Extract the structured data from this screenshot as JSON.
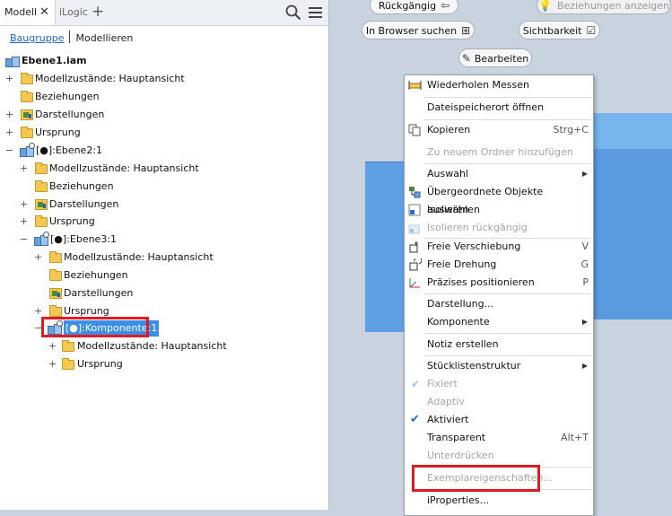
{
  "tabs": {
    "model": "Modell",
    "ilogic": "iLogic",
    "add": "+"
  },
  "modes": {
    "assembly": "Baugruppe",
    "modeling": "Modellieren"
  },
  "tree": {
    "root": "Ebene1.iam",
    "n1": "Modellzustände: Hauptansicht",
    "n2": "Beziehungen",
    "n3": "Darstellungen",
    "n4": "Ursprung",
    "n5": "[●]:Ebene2:1",
    "n6": "Modellzustände: Hauptansicht",
    "n7": "Beziehungen",
    "n8": "Darstellungen",
    "n9": "Ursprung",
    "n10": "[●]:Ebene3:1",
    "n11": "Modellzustände: Hauptansicht",
    "n12": "Beziehungen",
    "n13": "Darstellungen",
    "n14": "Ursprung",
    "n15": "[●]:Komponente:1",
    "n16": "Modellzustände: Hauptansicht",
    "n17": "Ursprung"
  },
  "view_buttons": {
    "undo": "Rückgängig",
    "show_relations": "Beziehungen anzeigen",
    "find_in_browser": "In Browser suchen",
    "visibility": "Sichtbarkeit",
    "edit": "Bearbeiten"
  },
  "menu": {
    "repeat_measure": "Wiederholen Messen",
    "open_location": "Dateispeicherort öffnen",
    "copy": "Kopieren",
    "copy_sc": "Strg+C",
    "add_folder": "Zu neuem Ordner hinzufügen",
    "selection": "Auswahl",
    "select_parents": "Übergeordnete Objekte auswählen",
    "isolate": "Isolieren",
    "undo_isolate": "Isolieren rückgängig",
    "free_move": "Freie Verschiebung",
    "free_move_sc": "V",
    "free_rotate": "Freie Drehung",
    "free_rotate_sc": "G",
    "precise_pos": "Präzises positionieren",
    "precise_pos_sc": "P",
    "representation": "Darstellung...",
    "component": "Komponente",
    "create_note": "Notiz erstellen",
    "bom_structure": "Stücklistenstruktur",
    "grounded": "Fixiert",
    "adaptive": "Adaptiv",
    "enabled": "Aktiviert",
    "transparent": "Transparent",
    "transparent_sc": "Alt+T",
    "suppress": "Unterdrücken",
    "instance_props": "Exemplareigenschaften...",
    "iproperties": "iProperties..."
  },
  "colors": {
    "highlight_red": "#e01b24",
    "selection_blue": "#3a8ee6",
    "check_blue": "#1a6fd6"
  }
}
